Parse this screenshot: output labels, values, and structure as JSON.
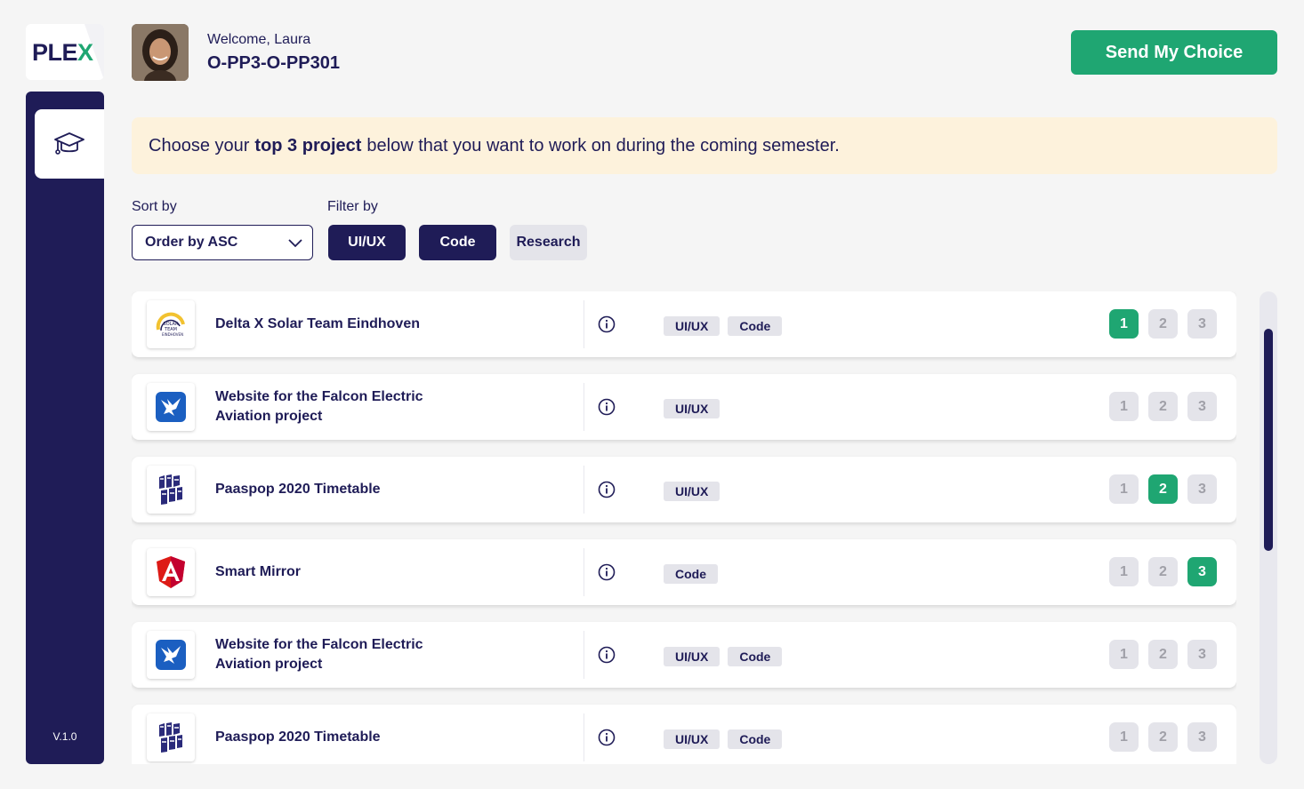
{
  "app": {
    "logo_text": "PLEX",
    "version": "V.1.0"
  },
  "header": {
    "welcome": "Welcome, Laura",
    "course_code": "O-PP3-O-PP301",
    "send_label": "Send My Choice"
  },
  "banner": {
    "before": "Choose your",
    "bold": "top 3 project",
    "after": "below that you want to work on during the coming semester."
  },
  "controls": {
    "sort_label": "Sort by",
    "sort_value": "Order by ASC",
    "filter_label": "Filter by",
    "filters": [
      {
        "label": "UI/UX",
        "active": true
      },
      {
        "label": "Code",
        "active": true
      },
      {
        "label": "Research",
        "active": false
      }
    ]
  },
  "projects": [
    {
      "title": "Delta X Solar Team Eindhoven",
      "logo": "solar-team-logo",
      "tags": [
        "UI/UX",
        "Code"
      ],
      "rank": 1
    },
    {
      "title": "Website for the Falcon Electric Aviation project",
      "logo": "falcon-logo",
      "tags": [
        "UI/UX"
      ],
      "rank": null
    },
    {
      "title": "Paaspop 2020 Timetable",
      "logo": "paaspop-logo",
      "tags": [
        "UI/UX"
      ],
      "rank": 2
    },
    {
      "title": "Smart Mirror",
      "logo": "angular-logo",
      "tags": [
        "Code"
      ],
      "rank": 3
    },
    {
      "title": "Website for the Falcon Electric Aviation project",
      "logo": "falcon-logo",
      "tags": [
        "UI/UX",
        "Code"
      ],
      "rank": null
    },
    {
      "title": "Paaspop 2020 Timetable",
      "logo": "paaspop-logo",
      "tags": [
        "UI/UX",
        "Code"
      ],
      "rank": null
    }
  ],
  "rank_labels": [
    "1",
    "2",
    "3"
  ],
  "colors": {
    "navy": "#1f1c57",
    "green": "#1fa672",
    "banner": "#fdf2dc",
    "chip_off": "#e4e4ea"
  }
}
